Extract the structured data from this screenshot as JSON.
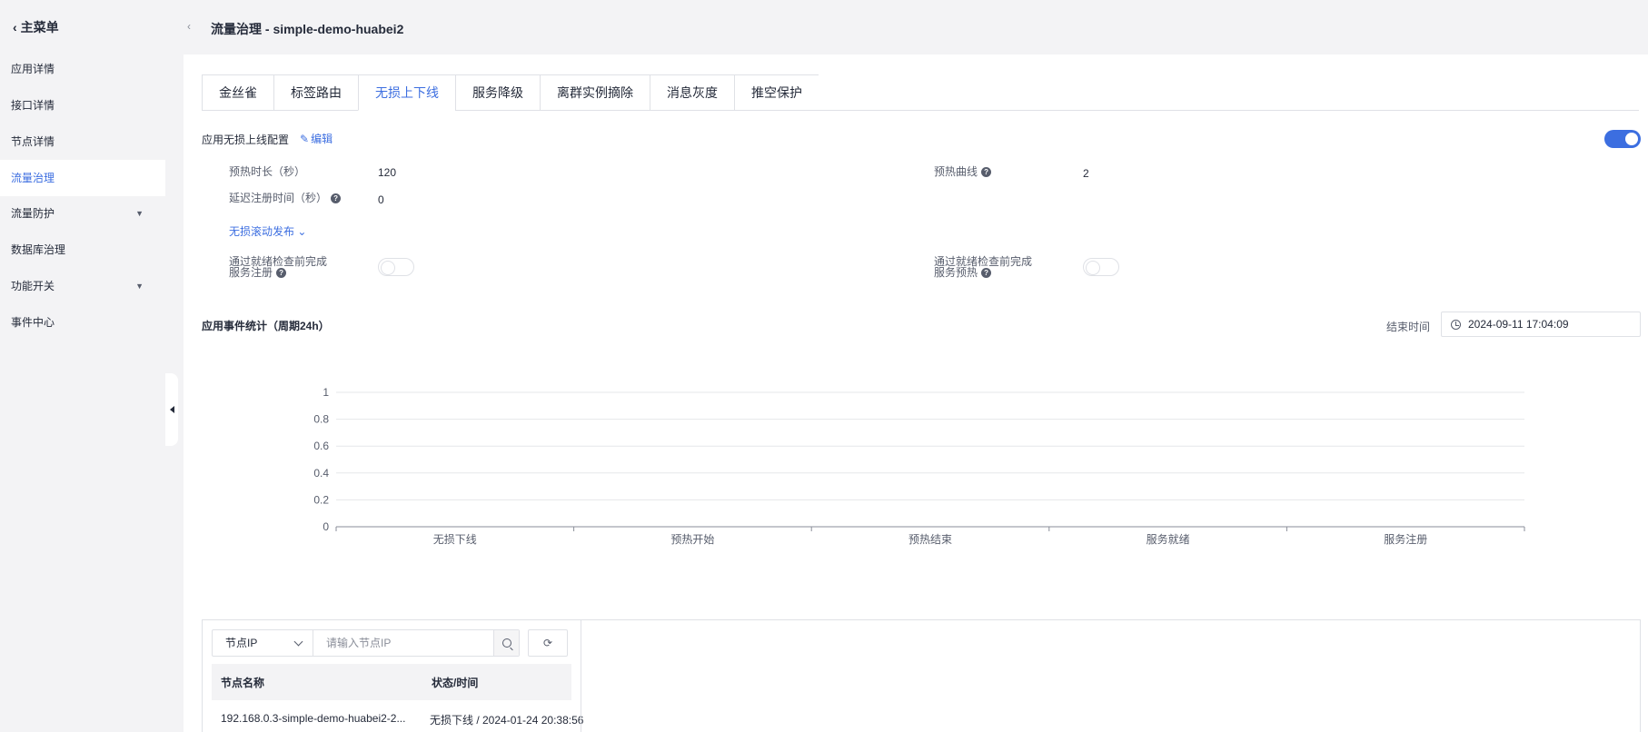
{
  "sidebar": {
    "back_label": "主菜单",
    "items": [
      {
        "label": "应用详情"
      },
      {
        "label": "接口详情"
      },
      {
        "label": "节点详情"
      },
      {
        "label": "流量治理"
      },
      {
        "label": "流量防护"
      },
      {
        "label": "数据库治理"
      },
      {
        "label": "功能开关"
      },
      {
        "label": "事件中心"
      }
    ],
    "active": "流量治理"
  },
  "header": {
    "title": "流量治理 - simple-demo-huabei2"
  },
  "tabs": [
    {
      "label": "金丝雀"
    },
    {
      "label": "标签路由"
    },
    {
      "label": "无损上下线"
    },
    {
      "label": "服务降级"
    },
    {
      "label": "离群实例摘除"
    },
    {
      "label": "消息灰度"
    },
    {
      "label": "推空保护"
    }
  ],
  "active_tab": "无损上下线",
  "config": {
    "title": "应用无损上线配置",
    "edit_label": "编辑",
    "enabled": true,
    "warmup_duration_label": "预热时长（秒）",
    "warmup_duration_value": "120",
    "warmup_curve_label": "预热曲线",
    "warmup_curve_value": "2",
    "delay_register_label": "延迟注册时间（秒）",
    "delay_register_value": "0",
    "rolling_release_label": "无损滚动发布",
    "readiness_register_label_line1": "通过就绪检查前完成",
    "readiness_register_label_line2": "服务注册",
    "readiness_register_enabled": false,
    "readiness_warmup_label_line1": "通过就绪检查前完成",
    "readiness_warmup_label_line2": "服务预热",
    "readiness_warmup_enabled": false
  },
  "stats": {
    "title": "应用事件统计（周期24h）",
    "end_time_label": "结束时间",
    "end_time_value": "2024-09-11 17:04:09"
  },
  "chart_data": {
    "type": "bar",
    "categories": [
      "无损下线",
      "预热开始",
      "预热结束",
      "服务就绪",
      "服务注册"
    ],
    "values": [
      0,
      0,
      0,
      0,
      0
    ],
    "title": "",
    "xlabel": "",
    "ylabel": "",
    "ylim": [
      0,
      1
    ],
    "yticks": [
      "0",
      "0.2",
      "0.4",
      "0.6",
      "0.8",
      "1"
    ],
    "grid": true
  },
  "nodes": {
    "select_value": "节点IP",
    "search_placeholder": "请输入节点IP",
    "columns": [
      "节点名称",
      "状态/时间"
    ],
    "rows": [
      {
        "name": "192.168.0.3-simple-demo-huabei2-2...",
        "status": "无损下线 / 2024-01-24 20:38:56"
      }
    ]
  },
  "colors": {
    "accent": "#3c6ee0",
    "text": "#252b3a",
    "border": "#dfe1e6"
  }
}
